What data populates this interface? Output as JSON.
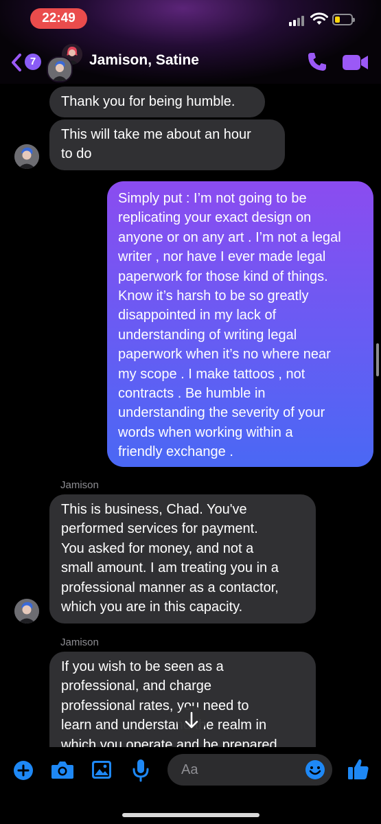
{
  "status_bar": {
    "time": "22:49",
    "time_pill_color": "#ea4c4c",
    "battery_level": 0.2
  },
  "header": {
    "back_badge_count": "7",
    "title": "Jamison, Satine",
    "accent_color": "#9b59f6",
    "icons": [
      "back-chevron-icon",
      "phone-icon",
      "video-camera-icon"
    ]
  },
  "messages": [
    {
      "direction": "incoming",
      "text": "Thank you for being humble."
    },
    {
      "direction": "incoming",
      "text": "This will take me about an hour\nto do"
    },
    {
      "direction": "outgoing",
      "text": "Simply put : I’m not going to be\nreplicating your exact design on\nanyone or on any art . I’m not a legal\nwriter , nor have I ever made legal\npaperwork for those kind of things.\nKnow it’s harsh to be so greatly\ndisappointed in my lack of\nunderstanding of writing legal\npaperwork when it’s no where near\nmy scope . I make tattoos , not\ncontracts .  Be humble in\nunderstanding the severity of your\nwords when working within a\nfriendly exchange ."
    },
    {
      "direction": "incoming",
      "sender": "Jamison",
      "text": "This is business, Chad. You've\nperformed services for payment.\nYou asked for money, and not a\nsmall amount. I am treating you in a\nprofessional manner as a contactor,\nwhich you are in this capacity."
    },
    {
      "direction": "incoming",
      "sender": "Jamison",
      "text": "If you wish to be seen as a\nprofessional, and charge\nprofessional rates, you need to\nlearn and understand the realm in\nwhich you operate and be prepared"
    }
  ],
  "composer": {
    "placeholder": "Aa",
    "icons": [
      "plus-icon",
      "camera-icon",
      "photo-icon",
      "microphone-icon",
      "emoji-icon",
      "thumbs-up-icon"
    ],
    "icon_color": "#1e88f5"
  },
  "jump_to_latest_icon": "arrow-down-icon"
}
